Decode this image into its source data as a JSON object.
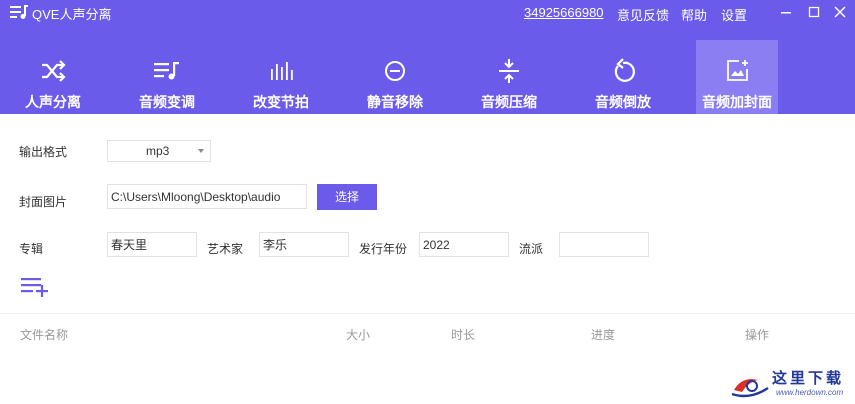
{
  "titlebar": {
    "app_title": "QVE人声分离",
    "phone": "34925666980",
    "feedback": "意见反馈",
    "help": "帮助",
    "settings": "设置"
  },
  "tabs": [
    {
      "label": "人声分离",
      "icon": "shuffle-icon",
      "active": false
    },
    {
      "label": "音频变调",
      "icon": "playlist-music-icon",
      "active": false
    },
    {
      "label": "改变节拍",
      "icon": "bars-icon",
      "active": false
    },
    {
      "label": "静音移除",
      "icon": "minus-circle-icon",
      "active": false
    },
    {
      "label": "音频压缩",
      "icon": "compress-icon",
      "active": false
    },
    {
      "label": "音频倒放",
      "icon": "rotate-left-icon",
      "active": false
    },
    {
      "label": "音频加封面",
      "icon": "image-add-icon",
      "active": true
    }
  ],
  "form": {
    "output_format_label": "输出格式",
    "output_format_value": "mp3",
    "cover_label": "封面图片",
    "cover_path": "C:\\Users\\Mloong\\Desktop\\audio",
    "select_button": "选择",
    "album_label": "专辑",
    "album_value": "春天里",
    "artist_label": "艺术家",
    "artist_value": "李乐",
    "year_label": "发行年份",
    "year_value": "2022",
    "genre_label": "流派",
    "genre_value": ""
  },
  "table": {
    "columns": [
      "文件名称",
      "大小",
      "时长",
      "进度",
      "操作"
    ]
  },
  "watermark": {
    "text": "这里下载",
    "url": "www.herdown.com"
  },
  "colors": {
    "accent": "#6a5bea",
    "active_tab": "#8a7ef2"
  }
}
